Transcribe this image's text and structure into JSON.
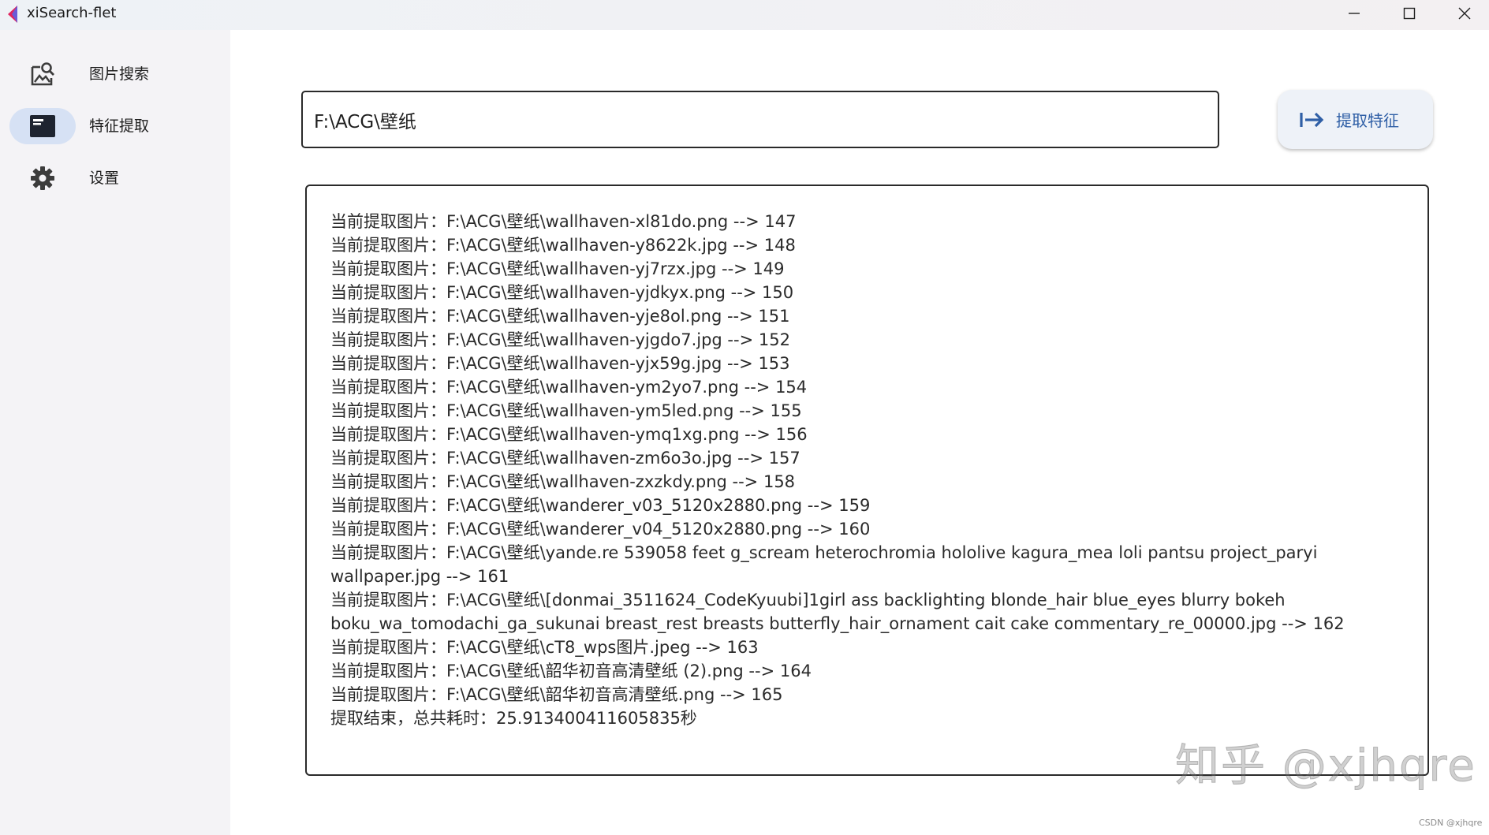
{
  "window": {
    "title": "xiSearch-flet"
  },
  "sidebar": {
    "items": [
      {
        "label": "图片搜索",
        "icon": "image-search-icon",
        "active": false
      },
      {
        "label": "特征提取",
        "icon": "feature-extract-icon",
        "active": true
      },
      {
        "label": "设置",
        "icon": "gear-icon",
        "active": false
      }
    ]
  },
  "main": {
    "path_input": {
      "value": "F:\\ACG\\壁纸"
    },
    "extract_button": {
      "label": "提取特征",
      "icon": "arrow-right-to-line-icon"
    },
    "log_lines": [
      "当前提取图片：F:\\ACG\\壁纸\\wallhaven-xl81do.png --> 147",
      "当前提取图片：F:\\ACG\\壁纸\\wallhaven-y8622k.jpg --> 148",
      "当前提取图片：F:\\ACG\\壁纸\\wallhaven-yj7rzx.jpg --> 149",
      "当前提取图片：F:\\ACG\\壁纸\\wallhaven-yjdkyx.png --> 150",
      "当前提取图片：F:\\ACG\\壁纸\\wallhaven-yje8ol.png --> 151",
      "当前提取图片：F:\\ACG\\壁纸\\wallhaven-yjgdo7.jpg --> 152",
      "当前提取图片：F:\\ACG\\壁纸\\wallhaven-yjx59g.jpg --> 153",
      "当前提取图片：F:\\ACG\\壁纸\\wallhaven-ym2yo7.png --> 154",
      "当前提取图片：F:\\ACG\\壁纸\\wallhaven-ym5led.png --> 155",
      "当前提取图片：F:\\ACG\\壁纸\\wallhaven-ymq1xg.png --> 156",
      "当前提取图片：F:\\ACG\\壁纸\\wallhaven-zm6o3o.jpg --> 157",
      "当前提取图片：F:\\ACG\\壁纸\\wallhaven-zxzkdy.png --> 158",
      "当前提取图片：F:\\ACG\\壁纸\\wanderer_v03_5120x2880.png --> 159",
      "当前提取图片：F:\\ACG\\壁纸\\wanderer_v04_5120x2880.png --> 160",
      "当前提取图片：F:\\ACG\\壁纸\\yande.re 539058 feet g_scream heterochromia hololive kagura_mea loli pantsu project_paryi wallpaper.jpg --> 161",
      "当前提取图片：F:\\ACG\\壁纸\\[donmai_3511624_CodeKyuubi]1girl ass backlighting blonde_hair blue_eyes blurry bokeh boku_wa_tomodachi_ga_sukunai breast_rest breasts butterfly_hair_ornament cait cake commentary_re_00000.jpg --> 162",
      "当前提取图片：F:\\ACG\\壁纸\\cT8_wps图片.jpeg --> 163",
      "当前提取图片：F:\\ACG\\壁纸\\韶华初音高清壁纸 (2).png --> 164",
      "当前提取图片：F:\\ACG\\壁纸\\韶华初音高清壁纸.png --> 165",
      "提取结束，总共耗时：25.913400411605835秒"
    ]
  },
  "watermarks": {
    "zhihu": "知乎 @xjhqre",
    "csdn": "CSDN @xjhqre"
  },
  "colors": {
    "accent": "#2f5fa6",
    "active_nav_bg": "#d6e1f4",
    "sidebar_bg": "#f4f3f6"
  }
}
